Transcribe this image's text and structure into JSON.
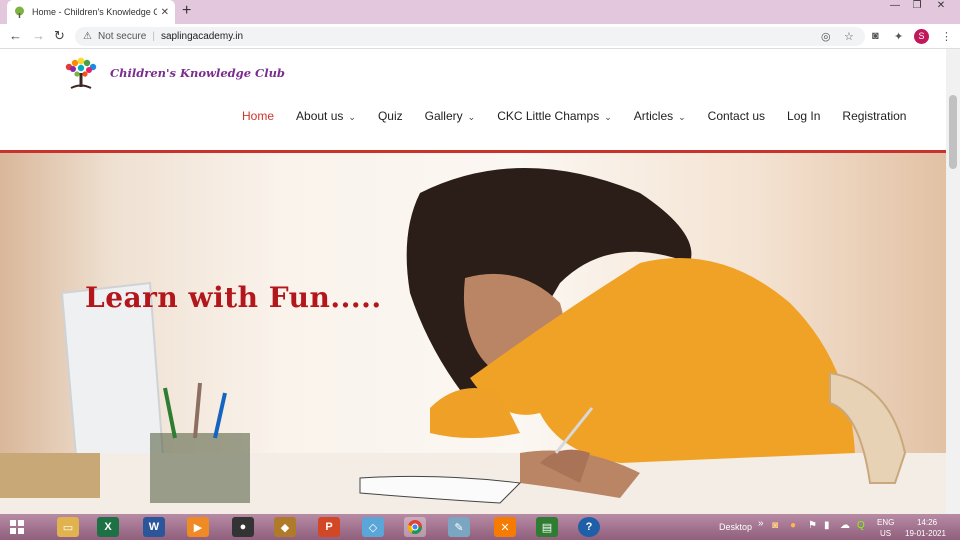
{
  "browser": {
    "tab_title": "Home - Children's Knowledge Cl",
    "new_tab_label": "+",
    "not_secure": "Not secure",
    "url": "saplingacademy.in",
    "profile_initial": "S"
  },
  "site": {
    "brand": "Children's Knowledge Club",
    "nav": [
      {
        "label": "Home",
        "active": true,
        "dropdown": false
      },
      {
        "label": "About us",
        "dropdown": true
      },
      {
        "label": "Quiz",
        "dropdown": false
      },
      {
        "label": "Gallery",
        "dropdown": true
      },
      {
        "label": "CKC Little Champs",
        "dropdown": true
      },
      {
        "label": "Articles",
        "dropdown": true
      },
      {
        "label": "Contact us",
        "dropdown": false
      },
      {
        "label": "Log In",
        "dropdown": false
      },
      {
        "label": "Registration",
        "dropdown": false
      }
    ],
    "hero_text": "Learn with Fun....."
  },
  "taskbar": {
    "desktop_label": "Desktop",
    "lang": "ENG",
    "region": "US",
    "time": "14:26",
    "date": "19-01-2021"
  },
  "colors": {
    "accent_red": "#c8342b",
    "brand_purple": "#7b2d8e"
  }
}
